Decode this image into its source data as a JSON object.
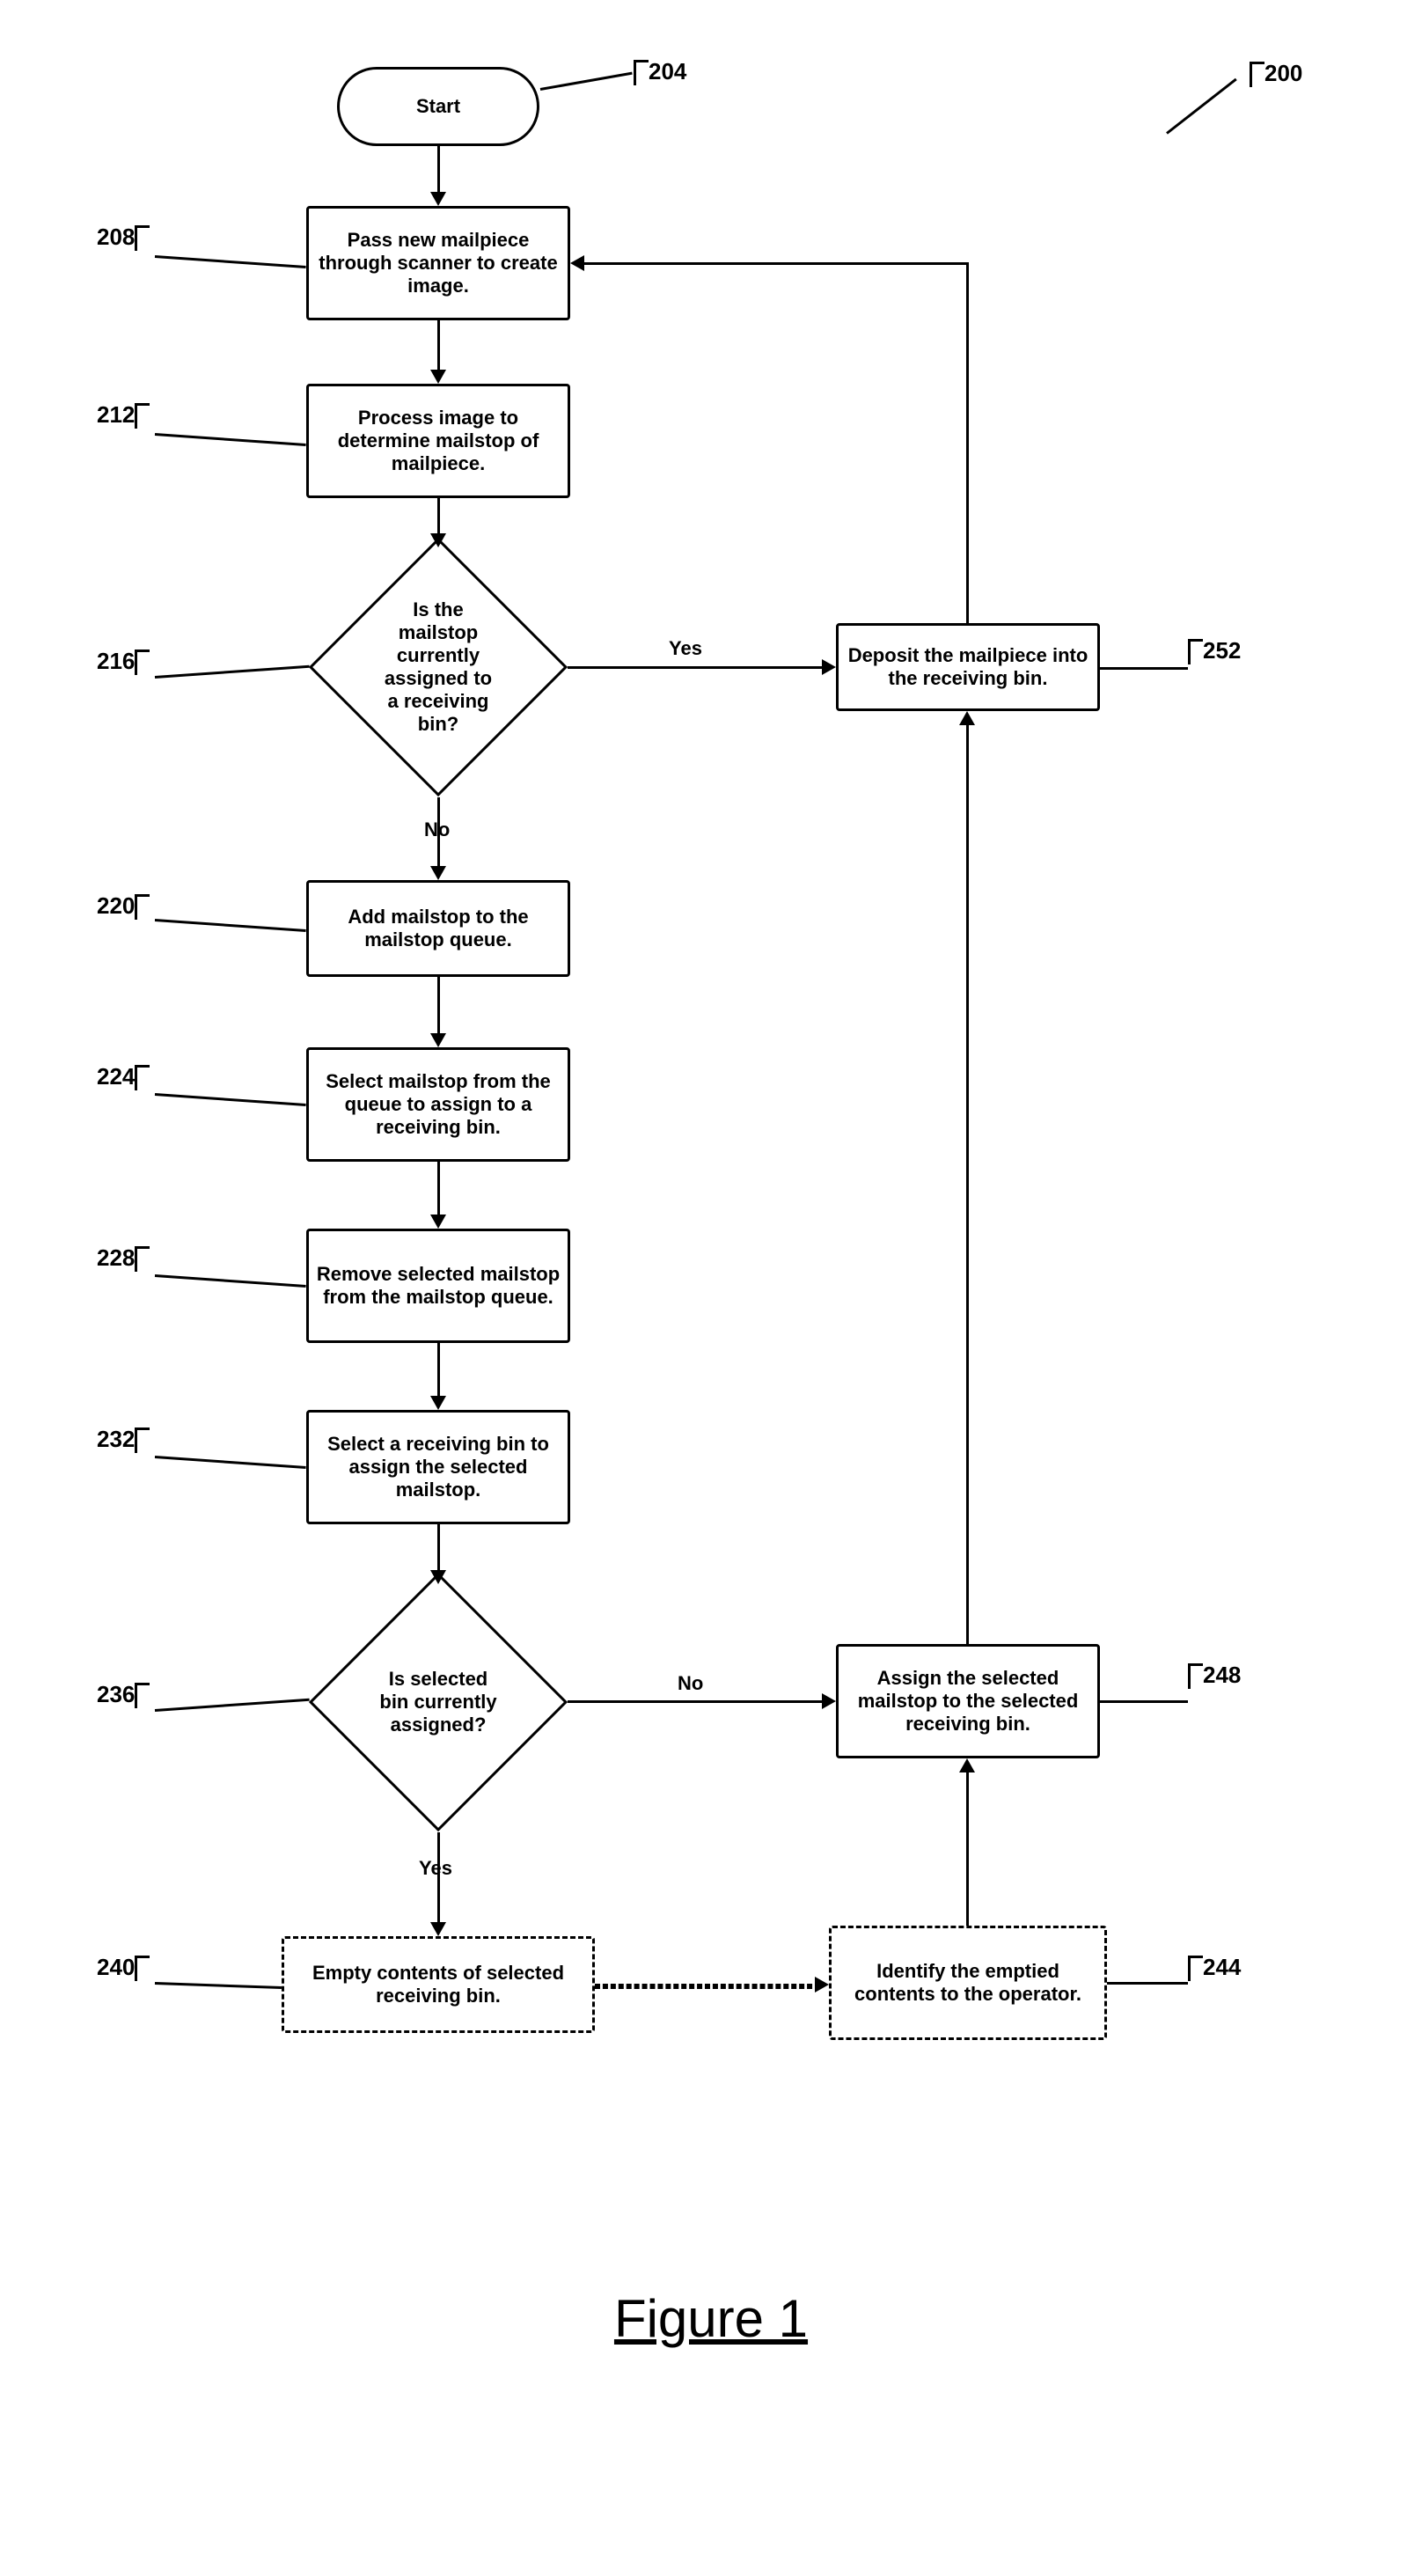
{
  "figure_caption": "Figure 1",
  "refs": {
    "r200": "200",
    "r204": "204",
    "r208": "208",
    "r212": "212",
    "r216": "216",
    "r220": "220",
    "r224": "224",
    "r228": "228",
    "r232": "232",
    "r236": "236",
    "r240": "240",
    "r244": "244",
    "r248": "248",
    "r252": "252"
  },
  "nodes": {
    "start": "Start",
    "n208": "Pass new mailpiece through scanner to create image.",
    "n212": "Process image to determine mailstop of mailpiece.",
    "n216": "Is the mailstop currently assigned to a receiving bin?",
    "n220": "Add mailstop to the mailstop queue.",
    "n224": "Select mailstop from the queue to assign to a receiving bin.",
    "n228": "Remove selected mailstop from the mailstop queue.",
    "n232": "Select a receiving bin to assign the selected mailstop.",
    "n236": "Is selected bin currently assigned?",
    "n240": "Empty contents of selected receiving bin.",
    "n244": "Identify the emptied contents to the operator.",
    "n248": "Assign the selected mailstop to the selected receiving bin.",
    "n252": "Deposit the mailpiece into the receiving bin."
  },
  "labels": {
    "yes1": "Yes",
    "no1": "No",
    "yes2": "Yes",
    "no2": "No"
  }
}
